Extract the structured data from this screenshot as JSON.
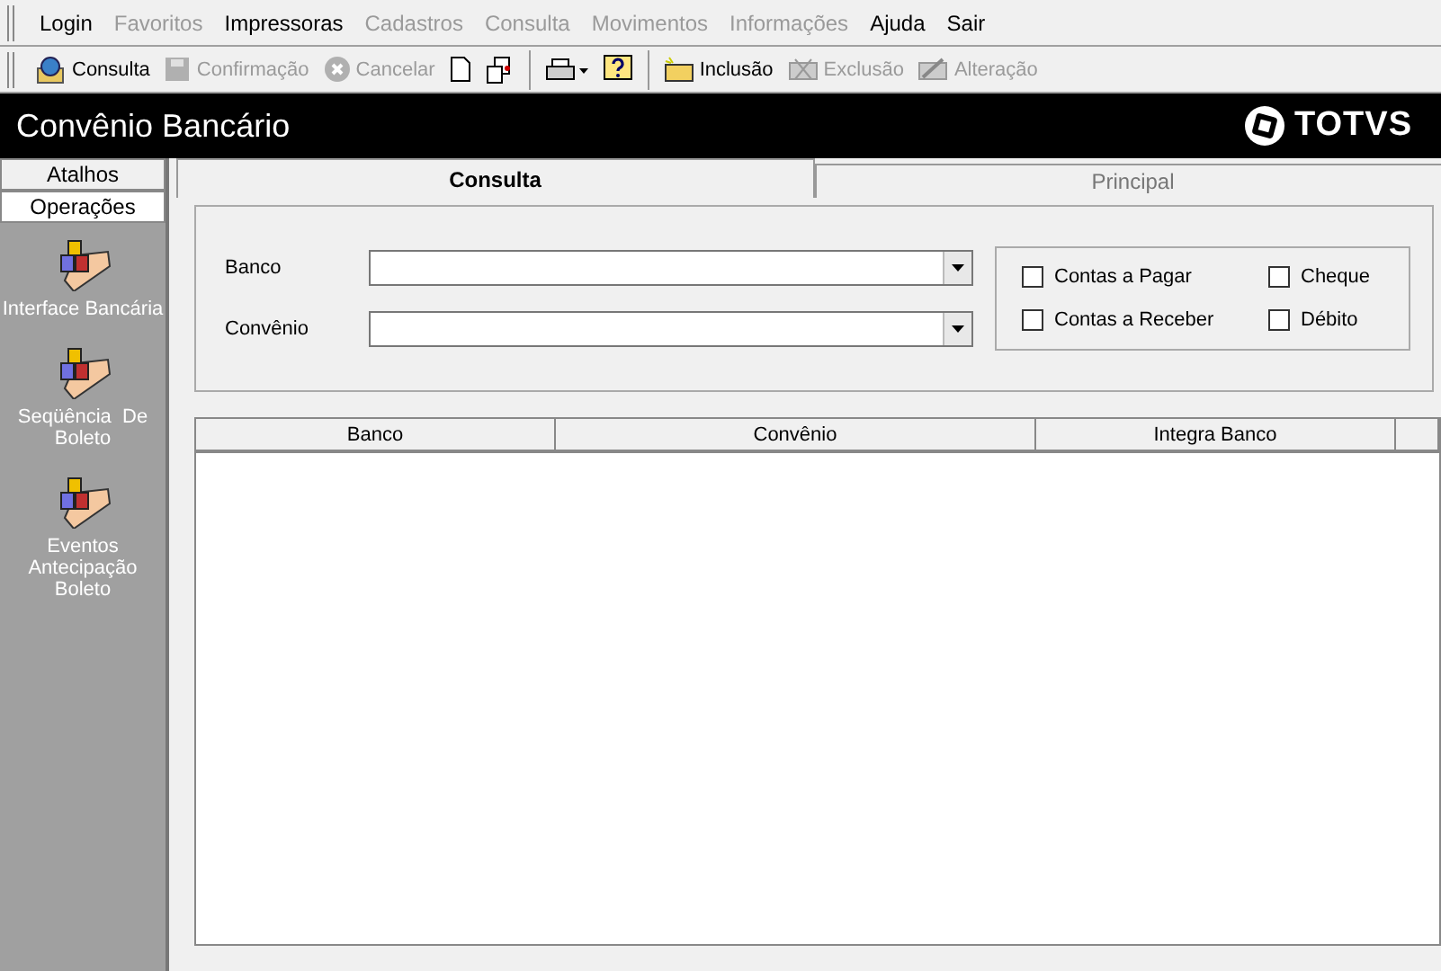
{
  "menu": [
    {
      "label": "Login",
      "disabled": false
    },
    {
      "label": "Favoritos",
      "disabled": true
    },
    {
      "label": "Impressoras",
      "disabled": false
    },
    {
      "label": "Cadastros",
      "disabled": true
    },
    {
      "label": "Consulta",
      "disabled": true
    },
    {
      "label": "Movimentos",
      "disabled": true
    },
    {
      "label": "Informações",
      "disabled": true
    },
    {
      "label": "Ajuda",
      "disabled": false
    },
    {
      "label": "Sair",
      "disabled": false
    }
  ],
  "toolbar": [
    {
      "kind": "button",
      "label": "Consulta",
      "disabled": false
    },
    {
      "kind": "button",
      "label": "Confirmação",
      "disabled": true
    },
    {
      "kind": "button",
      "label": "Cancelar",
      "disabled": true
    },
    {
      "kind": "icon"
    },
    {
      "kind": "icon"
    },
    {
      "kind": "separator"
    },
    {
      "kind": "icon"
    },
    {
      "kind": "icon"
    },
    {
      "kind": "separator"
    },
    {
      "kind": "button",
      "label": "Inclusão",
      "disabled": false
    },
    {
      "kind": "button",
      "label": "Exclusão",
      "disabled": true
    },
    {
      "kind": "button",
      "label": "Alteração",
      "disabled": true
    }
  ],
  "window": {
    "title": "Convênio Bancário",
    "logo": "TOTVS"
  },
  "sidebar": {
    "sections": [
      {
        "label": "Atalhos",
        "selected": false
      },
      {
        "label": "Operações",
        "selected": true
      }
    ],
    "items": [
      {
        "label": "Interface Bancária"
      },
      {
        "label": "Seqüência  De Boleto"
      },
      {
        "label": "Eventos Antecipação Boleto"
      }
    ]
  },
  "tabs": [
    {
      "label": "Consulta",
      "selected": true
    },
    {
      "label": "Principal",
      "selected": false
    }
  ],
  "filters": {
    "fields": [
      {
        "label": "Banco"
      },
      {
        "label": "Convênio"
      }
    ],
    "checkboxes": [
      {
        "label": "Contas a Pagar",
        "checked": false
      },
      {
        "label": "Cheque",
        "checked": false
      },
      {
        "label": "Contas a Receber",
        "checked": false
      },
      {
        "label": "Débito",
        "checked": false
      }
    ]
  },
  "table": {
    "columns": [
      "Banco",
      "Convênio",
      "Integra Banco"
    ]
  }
}
